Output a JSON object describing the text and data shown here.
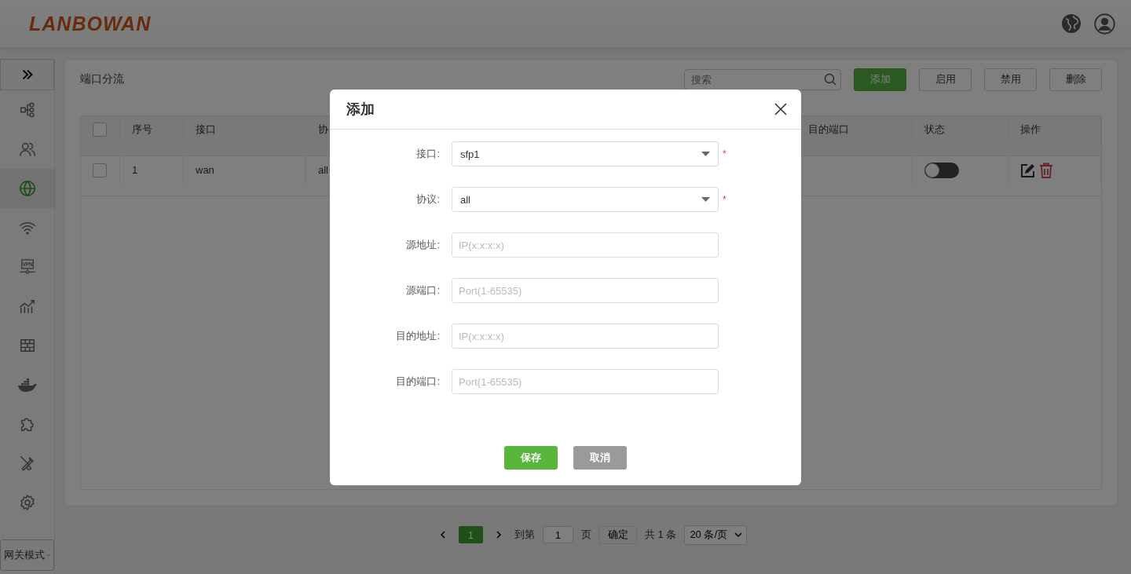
{
  "header": {
    "logo": "LANBOWAN"
  },
  "sidebar": {
    "items": [
      {
        "kind": "tree",
        "selected": false
      },
      {
        "kind": "users",
        "selected": false
      },
      {
        "kind": "globe",
        "selected": true
      },
      {
        "kind": "wifi",
        "selected": false
      },
      {
        "kind": "vpn",
        "badge": "VPN",
        "selected": false
      },
      {
        "kind": "chart",
        "selected": false
      },
      {
        "kind": "wall",
        "selected": false
      },
      {
        "kind": "whale",
        "selected": false
      },
      {
        "kind": "puzzle",
        "selected": false
      },
      {
        "kind": "tools",
        "selected": false
      },
      {
        "kind": "gear",
        "selected": false
      }
    ],
    "mode_select": {
      "value": "网关模式"
    }
  },
  "page": {
    "title": "端口分流",
    "search": {
      "placeholder": "搜索"
    },
    "buttons": [
      {
        "label": "添加",
        "primary": true
      },
      {
        "label": "启用",
        "primary": false
      },
      {
        "label": "禁用",
        "primary": false
      },
      {
        "label": "删除",
        "primary": false
      }
    ]
  },
  "table": {
    "columns": [
      "序号",
      "接口",
      "协",
      "目的端口",
      "状态",
      "操作"
    ],
    "rows": [
      {
        "checked": false,
        "cells": [
          "1",
          "wan",
          "all",
          ""
        ],
        "on": false
      }
    ],
    "header_checked": false
  },
  "pagination": {
    "pages": [
      {
        "label": "1",
        "selected": true
      }
    ],
    "goto_label": "到第",
    "goto_value": "1",
    "page_unit": "页",
    "confirm": "确定",
    "total": "共 1 条",
    "page_size": "20 条/页"
  },
  "dialog": {
    "title": "添加",
    "fields": [
      {
        "kind": "select",
        "label": "接口:",
        "value": "sfp1",
        "required_mark": "*"
      },
      {
        "kind": "select",
        "label": "协议:",
        "value": "all",
        "required_mark": "*"
      },
      {
        "kind": "input",
        "label": "源地址:",
        "placeholder": "IP(x:x:x:x)"
      },
      {
        "kind": "input",
        "label": "源端口:",
        "placeholder": "Port(1-65535)"
      },
      {
        "kind": "input",
        "label": "目的地址:",
        "placeholder": "IP(x:x:x:x)"
      },
      {
        "kind": "input",
        "label": "目的端口:",
        "placeholder": "Port(1-65535)"
      }
    ],
    "buttons": [
      {
        "label": "保存",
        "kind": "save"
      },
      {
        "label": "取消",
        "kind": "cancel"
      }
    ]
  }
}
